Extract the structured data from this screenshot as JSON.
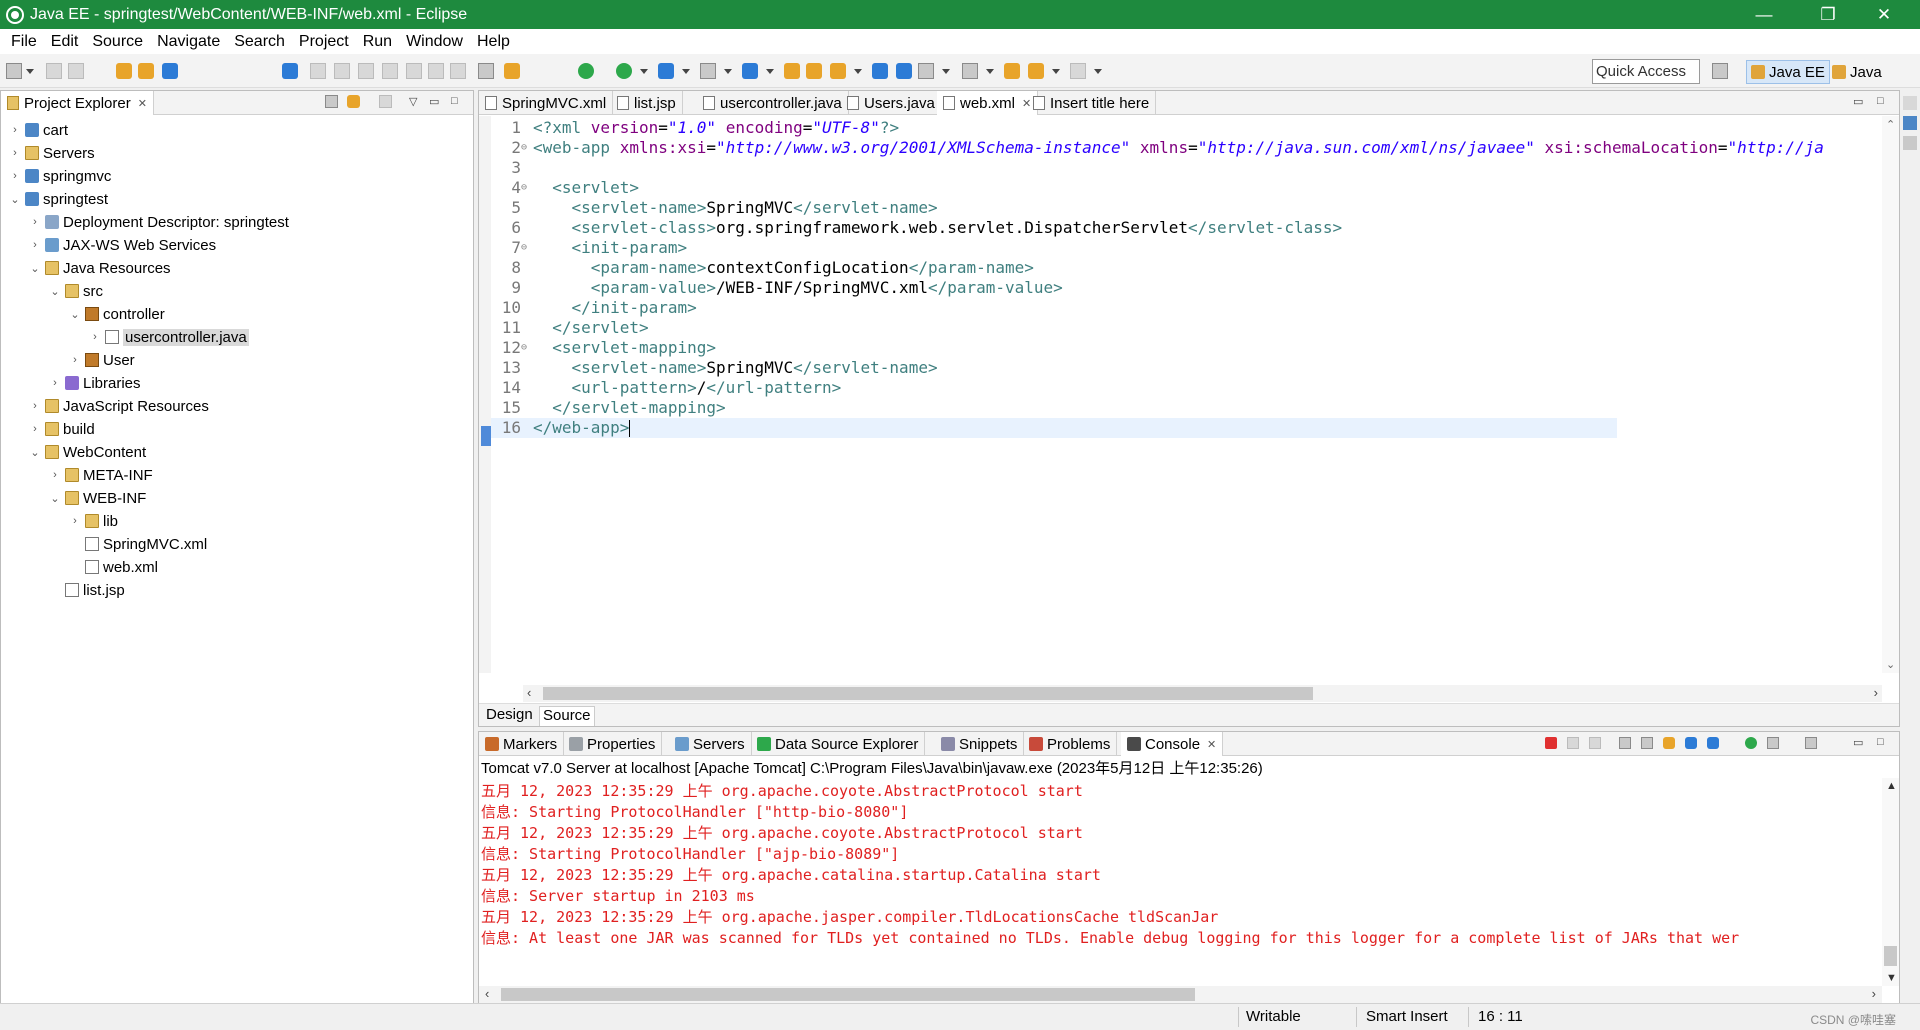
{
  "window": {
    "title": "Java EE - springtest/WebContent/WEB-INF/web.xml - Eclipse",
    "controls": {
      "minimize": "—",
      "restore": "❐",
      "close": "✕"
    }
  },
  "menu": [
    "File",
    "Edit",
    "Source",
    "Navigate",
    "Search",
    "Project",
    "Run",
    "Window",
    "Help"
  ],
  "toolbar": {
    "quick_access": "Quick Access",
    "perspectives": [
      {
        "label": "Java EE",
        "active": true
      },
      {
        "label": "Java",
        "active": false
      }
    ]
  },
  "project_explorer": {
    "title": "Project Explorer",
    "tree": [
      {
        "label": "cart",
        "twisty": "›",
        "icon": "project-icon"
      },
      {
        "label": "Servers",
        "twisty": "›",
        "icon": "folder-icon"
      },
      {
        "label": "springmvc",
        "twisty": "›",
        "icon": "project-icon"
      },
      {
        "label": "springtest",
        "twisty": "⌄",
        "icon": "project-icon"
      },
      {
        "label": "Deployment Descriptor: springtest",
        "twisty": "›",
        "icon": "deployment-descriptor-icon"
      },
      {
        "label": "JAX-WS Web Services",
        "twisty": "›",
        "icon": "web-services-icon"
      },
      {
        "label": "Java Resources",
        "twisty": "⌄",
        "icon": "java-resources-icon"
      },
      {
        "label": "src",
        "twisty": "⌄",
        "icon": "source-folder-icon"
      },
      {
        "label": "controller",
        "twisty": "⌄",
        "icon": "package-icon"
      },
      {
        "label": "usercontroller.java",
        "twisty": "›",
        "icon": "java-file-icon",
        "selected": true
      },
      {
        "label": "User",
        "twisty": "›",
        "icon": "package-icon"
      },
      {
        "label": "Libraries",
        "twisty": "›",
        "icon": "libraries-icon"
      },
      {
        "label": "JavaScript Resources",
        "twisty": "›",
        "icon": "javascript-resources-icon"
      },
      {
        "label": "build",
        "twisty": "›",
        "icon": "folder-icon"
      },
      {
        "label": "WebContent",
        "twisty": "⌄",
        "icon": "folder-icon"
      },
      {
        "label": "META-INF",
        "twisty": "›",
        "icon": "folder-icon"
      },
      {
        "label": "WEB-INF",
        "twisty": "⌄",
        "icon": "folder-icon"
      },
      {
        "label": "lib",
        "twisty": "›",
        "icon": "folder-icon"
      },
      {
        "label": "SpringMVC.xml",
        "twisty": "",
        "icon": "xml-file-icon"
      },
      {
        "label": "web.xml",
        "twisty": "",
        "icon": "xml-file-icon"
      },
      {
        "label": "list.jsp",
        "twisty": "",
        "icon": "jsp-file-icon"
      }
    ]
  },
  "editor": {
    "tabs": [
      {
        "label": "SpringMVC.xml",
        "active": false
      },
      {
        "label": "list.jsp",
        "active": false
      },
      {
        "label": "usercontroller.java",
        "active": false
      },
      {
        "label": "Users.java",
        "active": false
      },
      {
        "label": "web.xml",
        "active": true,
        "close": "✕"
      },
      {
        "label": "Insert title here",
        "active": false
      }
    ],
    "lines": [
      {
        "n": "1",
        "fold": "",
        "parts": [
          [
            "tag",
            "<?xml "
          ],
          [
            "attr",
            "version"
          ],
          [
            "txt",
            "="
          ],
          [
            "val",
            "\"1.0\""
          ],
          [
            "txt",
            " "
          ],
          [
            "attr",
            "encoding"
          ],
          [
            "txt",
            "="
          ],
          [
            "val",
            "\"UTF-8\""
          ],
          [
            "tag",
            "?>"
          ]
        ]
      },
      {
        "n": "2",
        "fold": "⊖",
        "parts": [
          [
            "tag",
            "<web-app "
          ],
          [
            "attr",
            "xmlns:xsi"
          ],
          [
            "txt",
            "="
          ],
          [
            "val",
            "\"http://www.w3.org/2001/XMLSchema-instance\""
          ],
          [
            "txt",
            " "
          ],
          [
            "attr",
            "xmlns"
          ],
          [
            "txt",
            "="
          ],
          [
            "val",
            "\"http://java.sun.com/xml/ns/javaee\""
          ],
          [
            "txt",
            " "
          ],
          [
            "attr",
            "xsi:schemaLocation"
          ],
          [
            "txt",
            "="
          ],
          [
            "val",
            "\"http://ja"
          ]
        ]
      },
      {
        "n": "3",
        "fold": "",
        "parts": []
      },
      {
        "n": "4",
        "fold": "⊖",
        "parts": [
          [
            "txt",
            "  "
          ],
          [
            "tag",
            "<servlet>"
          ]
        ]
      },
      {
        "n": "5",
        "fold": "",
        "parts": [
          [
            "txt",
            "    "
          ],
          [
            "tag",
            "<servlet-name>"
          ],
          [
            "txt",
            "SpringMVC"
          ],
          [
            "tag",
            "</servlet-name>"
          ]
        ]
      },
      {
        "n": "6",
        "fold": "",
        "parts": [
          [
            "txt",
            "    "
          ],
          [
            "tag",
            "<servlet-class>"
          ],
          [
            "txt",
            "org.springframework.web.servlet.DispatcherServlet"
          ],
          [
            "tag",
            "</servlet-class>"
          ]
        ]
      },
      {
        "n": "7",
        "fold": "⊖",
        "parts": [
          [
            "txt",
            "    "
          ],
          [
            "tag",
            "<init-param>"
          ]
        ]
      },
      {
        "n": "8",
        "fold": "",
        "parts": [
          [
            "txt",
            "      "
          ],
          [
            "tag",
            "<param-name>"
          ],
          [
            "txt",
            "contextConfigLocation"
          ],
          [
            "tag",
            "</param-name>"
          ]
        ]
      },
      {
        "n": "9",
        "fold": "",
        "parts": [
          [
            "txt",
            "      "
          ],
          [
            "tag",
            "<param-value>"
          ],
          [
            "txt",
            "/WEB-INF/SpringMVC.xml"
          ],
          [
            "tag",
            "</param-value>"
          ]
        ]
      },
      {
        "n": "10",
        "fold": "",
        "parts": [
          [
            "txt",
            "    "
          ],
          [
            "tag",
            "</init-param>"
          ]
        ]
      },
      {
        "n": "11",
        "fold": "",
        "parts": [
          [
            "txt",
            "  "
          ],
          [
            "tag",
            "</servlet>"
          ]
        ]
      },
      {
        "n": "12",
        "fold": "⊖",
        "parts": [
          [
            "txt",
            "  "
          ],
          [
            "tag",
            "<servlet-mapping>"
          ]
        ]
      },
      {
        "n": "13",
        "fold": "",
        "parts": [
          [
            "txt",
            "    "
          ],
          [
            "tag",
            "<servlet-name>"
          ],
          [
            "txt",
            "SpringMVC"
          ],
          [
            "tag",
            "</servlet-name>"
          ]
        ]
      },
      {
        "n": "14",
        "fold": "",
        "parts": [
          [
            "txt",
            "    "
          ],
          [
            "tag",
            "<url-pattern>"
          ],
          [
            "txt",
            "/"
          ],
          [
            "tag",
            "</url-pattern>"
          ]
        ]
      },
      {
        "n": "15",
        "fold": "",
        "parts": [
          [
            "txt",
            "  "
          ],
          [
            "tag",
            "</servlet-mapping>"
          ]
        ]
      },
      {
        "n": "16",
        "fold": "",
        "parts": [
          [
            "tag",
            "</web-app>"
          ]
        ],
        "current": true
      }
    ],
    "bottom_tabs": [
      {
        "label": "Design",
        "active": false
      },
      {
        "label": "Source",
        "active": true
      }
    ]
  },
  "bottom_panel": {
    "tabs": [
      {
        "label": "Markers",
        "active": false
      },
      {
        "label": "Properties",
        "active": false
      },
      {
        "label": "Servers",
        "active": false
      },
      {
        "label": "Data Source Explorer",
        "active": false
      },
      {
        "label": "Snippets",
        "active": false
      },
      {
        "label": "Problems",
        "active": false
      },
      {
        "label": "Console",
        "active": true,
        "close": "✕"
      }
    ],
    "console_header": "Tomcat v7.0 Server at localhost [Apache Tomcat] C:\\Program Files\\Java\\bin\\javaw.exe (2023年5月12日 上午12:35:26)",
    "console_lines": [
      "五月 12, 2023 12:35:29 上午 org.apache.coyote.AbstractProtocol start",
      "信息: Starting ProtocolHandler [\"http-bio-8080\"]",
      "五月 12, 2023 12:35:29 上午 org.apache.coyote.AbstractProtocol start",
      "信息: Starting ProtocolHandler [\"ajp-bio-8089\"]",
      "五月 12, 2023 12:35:29 上午 org.apache.catalina.startup.Catalina start",
      "信息: Server startup in 2103 ms",
      "五月 12, 2023 12:35:29 上午 org.apache.jasper.compiler.TldLocationsCache tldScanJar",
      "信息: At least one JAR was scanned for TLDs yet contained no TLDs. Enable debug logging for this logger for a complete list of JARs that wer"
    ]
  },
  "status": {
    "writable": "Writable",
    "insert_mode": "Smart Insert",
    "position": "16 : 11",
    "watermark": "CSDN @嗦哇塞"
  },
  "colors": {
    "titlebar": "#1e8a3e",
    "console_text": "#e02020",
    "xml_tag": "#3f7f7f",
    "xml_attr": "#7f007f",
    "xml_value": "#2a00ff"
  }
}
